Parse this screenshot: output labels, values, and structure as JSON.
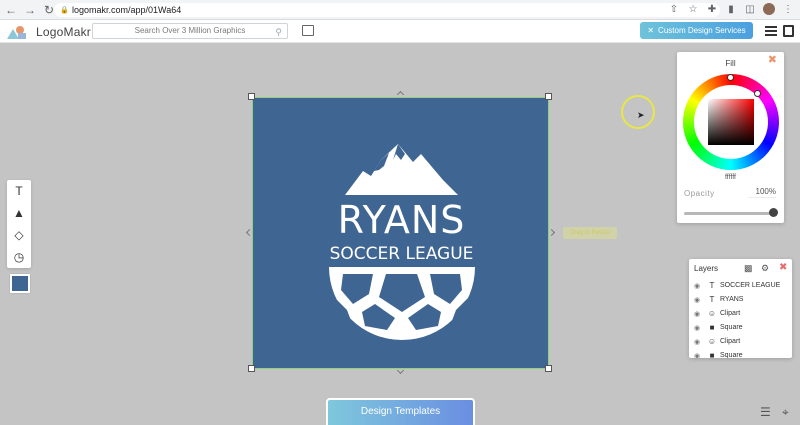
{
  "browser": {
    "url": "logomakr.com/app/01Wa64"
  },
  "app": {
    "brand": "LogoMakr",
    "search_placeholder": "Search Over 3 Million Graphics",
    "custom_btn": "Custom Design Services"
  },
  "canvas": {
    "bg_color": "#3f6592",
    "title": "RYANS",
    "subtitle": "SOCCER LEAGUE",
    "hint": "Drag to Resize"
  },
  "fill_panel": {
    "title": "Fill",
    "hex": "ffffff",
    "opacity_label": "Opacity",
    "opacity_value": "100%",
    "opacity_fraction": 1.0
  },
  "layers": {
    "title": "Layers",
    "items": [
      {
        "type": "text",
        "label": "SOCCER LEAGUE"
      },
      {
        "type": "text",
        "label": "RYANS"
      },
      {
        "type": "clipart",
        "label": "Clipart"
      },
      {
        "type": "square",
        "label": "Square"
      },
      {
        "type": "clipart",
        "label": "Clipart"
      },
      {
        "type": "square",
        "label": "Square"
      }
    ]
  },
  "bottom": {
    "templates_btn": "Design Templates"
  }
}
